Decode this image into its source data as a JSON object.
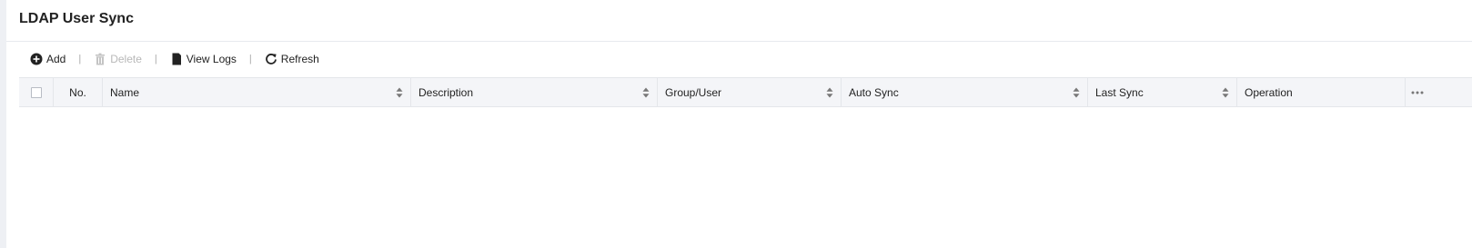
{
  "page": {
    "title": "LDAP User Sync"
  },
  "toolbar": {
    "add_label": "Add",
    "delete_label": "Delete",
    "view_logs_label": "View Logs",
    "refresh_label": "Refresh",
    "separator": "|"
  },
  "table": {
    "columns": [
      {
        "key": "select",
        "label": ""
      },
      {
        "key": "no",
        "label": "No."
      },
      {
        "key": "name",
        "label": "Name"
      },
      {
        "key": "description",
        "label": "Description"
      },
      {
        "key": "group_user",
        "label": "Group/User"
      },
      {
        "key": "auto_sync",
        "label": "Auto Sync"
      },
      {
        "key": "last_sync",
        "label": "Last Sync"
      },
      {
        "key": "operation",
        "label": "Operation"
      }
    ],
    "more_icon": "ellipsis-icon",
    "rows": []
  },
  "colors": {
    "header_bg": "#f4f5f8",
    "border": "#e4e6ea",
    "disabled_text": "#b8b8b8",
    "gutter": "#eef0f4"
  }
}
